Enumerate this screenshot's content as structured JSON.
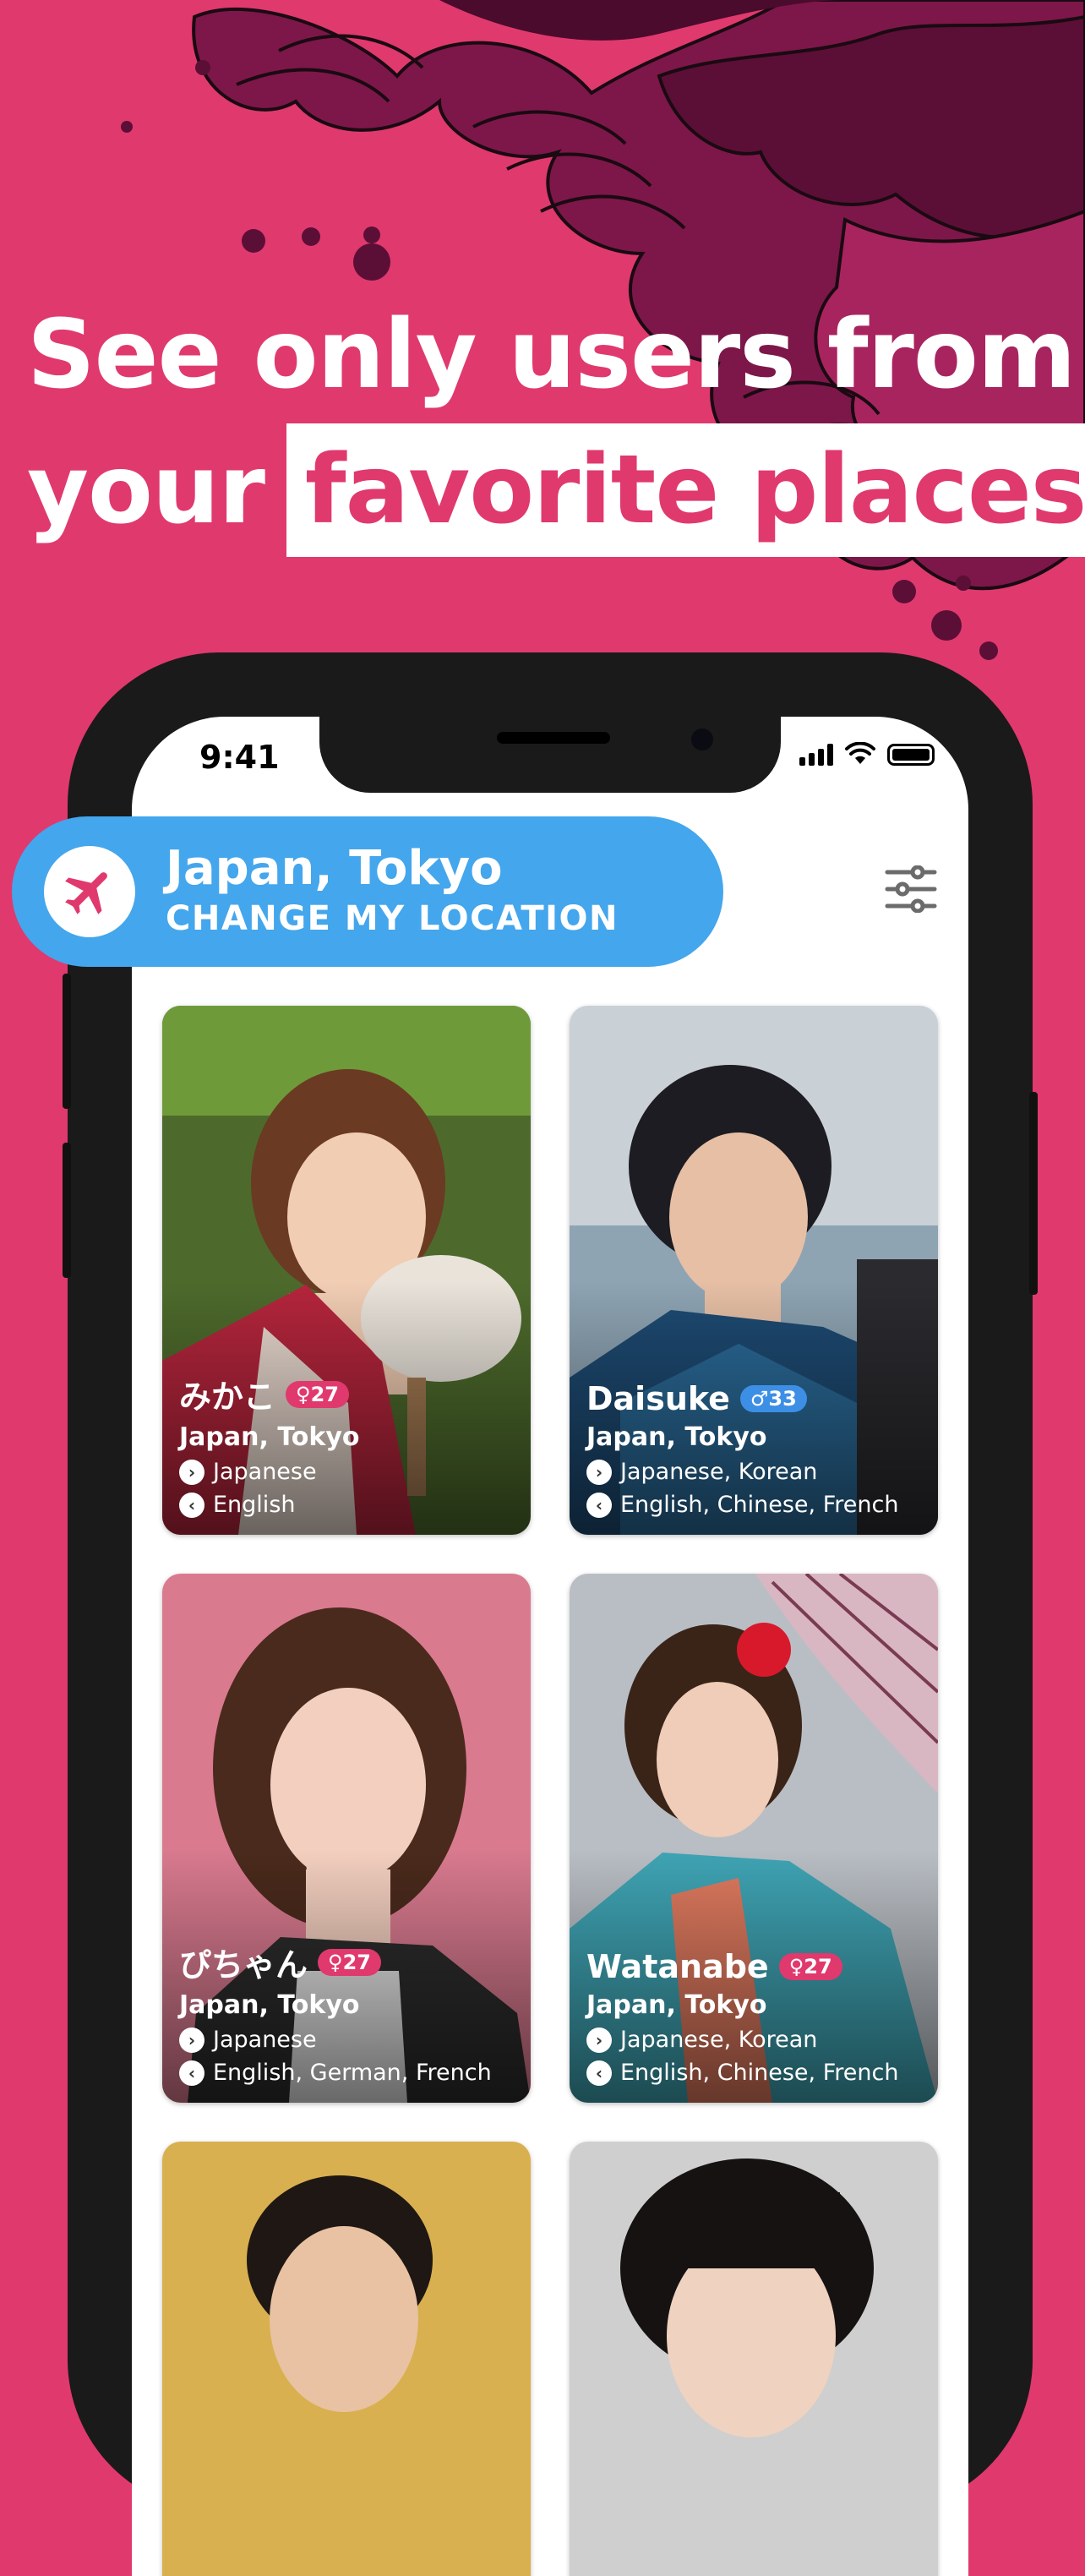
{
  "headline": {
    "line1": "See only users from",
    "line2_plain": "your",
    "line2_highlight": "favorite places"
  },
  "status_bar": {
    "time": "9:41"
  },
  "location": {
    "city": "Japan, Tokyo",
    "change_label": "CHANGE MY LOCATION",
    "icon": "airplane-icon"
  },
  "filter_icon": "sliders-icon",
  "colors": {
    "brand_pink": "#e0396e",
    "location_blue": "#44a6ec",
    "male_badge": "#3d8fe6"
  },
  "cards": [
    {
      "name": "みかこ",
      "gender": "female",
      "age": "♀27",
      "place": "Japan, Tokyo",
      "speaks": "Japanese",
      "learning": "English"
    },
    {
      "name": "Daisuke",
      "gender": "male",
      "age": "♂33",
      "place": "Japan, Tokyo",
      "speaks": "Japanese, Korean",
      "learning": "English, Chinese, French"
    },
    {
      "name": "ぴちゃん",
      "gender": "female",
      "age": "♀27",
      "place": "Japan, Tokyo",
      "speaks": "Japanese",
      "learning": "English, German, French"
    },
    {
      "name": "Watanabe",
      "gender": "female",
      "age": "♀27",
      "place": "Japan, Tokyo",
      "speaks": "Japanese, Korean",
      "learning": "English, Chinese, French"
    }
  ]
}
